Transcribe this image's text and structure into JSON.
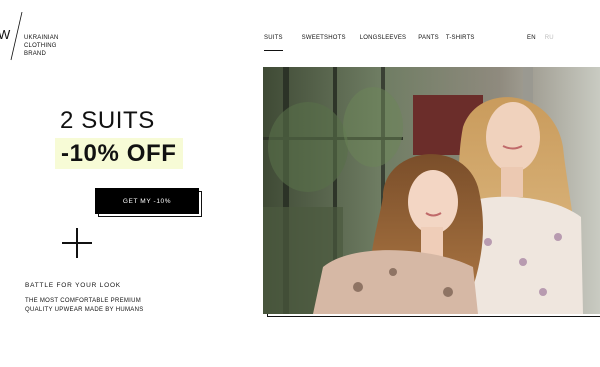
{
  "brand": {
    "logo_letter": "W",
    "lines": [
      "UKRAINIAN",
      "CLOTHING",
      "BRAND"
    ]
  },
  "nav": {
    "items": [
      "SUITS",
      "SWEETSHOTS",
      "LONGSLEEVES",
      "PANTS",
      "T-SHIRTS"
    ],
    "active_index": 0
  },
  "lang": {
    "en": "EN",
    "ru": "RU"
  },
  "hero": {
    "headline": "2 SUITS",
    "subhead": "-10% OFF",
    "cta_label": "GET MY -10%",
    "tagline": "BATTLE FOR YOUR LOOK",
    "desc_lines": [
      "THE MOST COMFORTABLE PREMIUM",
      "QUALITY UPWEAR MADE BY HUMANS"
    ]
  },
  "colors": {
    "highlight": "#f7fbd6",
    "button": "#000000",
    "text": "#111111",
    "muted": "#bdbdbd"
  },
  "icons": {
    "expand": "plus-icon"
  }
}
